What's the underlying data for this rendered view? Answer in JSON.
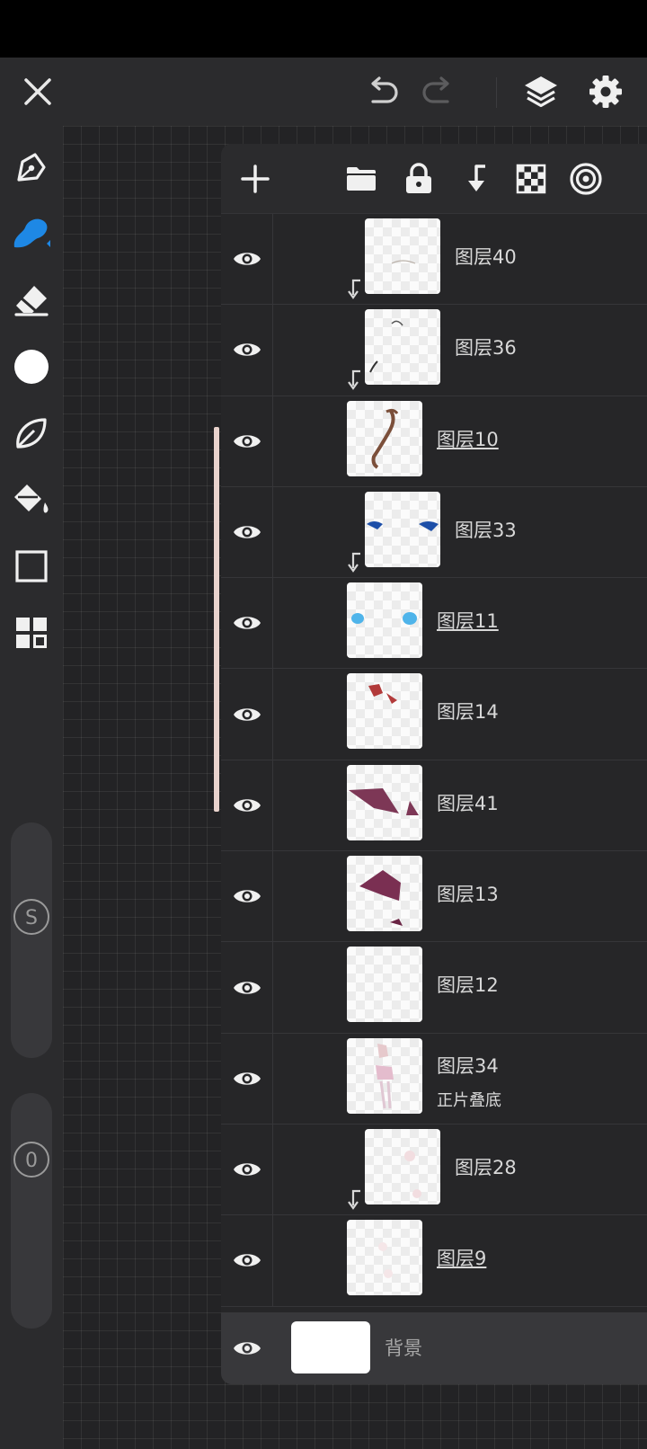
{
  "colors": {
    "accent": "#1e88e5",
    "panel": "#262628",
    "toolbar": "#2b2b2d",
    "range_bar": "#e9d3cd"
  },
  "top_bar": {
    "icons": [
      "close-icon",
      "undo-icon",
      "redo-icon",
      "layers-icon",
      "settings-icon"
    ]
  },
  "toolbar": {
    "tools": [
      "pen-icon",
      "brush-icon",
      "eraser-icon",
      "color-swatch",
      "smudge-leaf-icon",
      "fill-bucket-icon",
      "selection-rect-icon",
      "gallery-grid-icon"
    ],
    "active_tool": "brush-icon",
    "size_slider_label": "S",
    "opacity_slider_label": "0"
  },
  "layer_panel": {
    "actions": [
      "add-icon",
      "folder-icon",
      "lock-icon",
      "clipping-icon",
      "transparency-lock-icon",
      "reference-icon"
    ],
    "layers": [
      {
        "name": "图层40"
      },
      {
        "name": "图层36"
      },
      {
        "name": "图层10"
      },
      {
        "name": "图层33"
      },
      {
        "name": "图层11"
      },
      {
        "name": "图层14"
      },
      {
        "name": "图层41"
      },
      {
        "name": "图层13"
      },
      {
        "name": "图层12"
      },
      {
        "name": "图层34",
        "mode": "正片叠底"
      },
      {
        "name": "图层28"
      },
      {
        "name": "图层9"
      }
    ],
    "background": {
      "name": "背景"
    }
  }
}
